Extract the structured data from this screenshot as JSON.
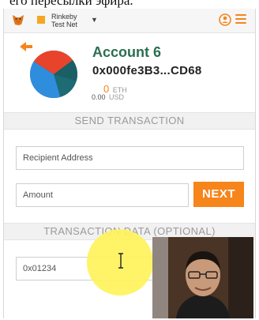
{
  "caption_text": "его пересылки эфира.",
  "network": {
    "name_line1": "Rinkeby",
    "name_line2": "Test Net",
    "color": "#f6a623"
  },
  "account": {
    "name": "Account 6",
    "address": "0x000fe3B3...CD68",
    "eth_balance": "0",
    "eth_unit": "ETH",
    "usd_balance": "0.00",
    "usd_unit": "USD"
  },
  "send": {
    "section_title": "SEND TRANSACTION",
    "recipient_placeholder": "Recipient Address",
    "amount_placeholder": "Amount",
    "next_label": "NEXT"
  },
  "tx_data": {
    "section_title": "TRANSACTION DATA (OPTIONAL)",
    "placeholder": "0x01234"
  },
  "colors": {
    "accent": "#f6851b",
    "account_name": "#2b6f4f"
  },
  "icons": [
    "metamask-fox-icon",
    "network-status-icon",
    "chevron-down-icon",
    "account-switch-icon",
    "menu-icon",
    "back-arrow-icon",
    "identicon",
    "text-cursor-icon"
  ]
}
